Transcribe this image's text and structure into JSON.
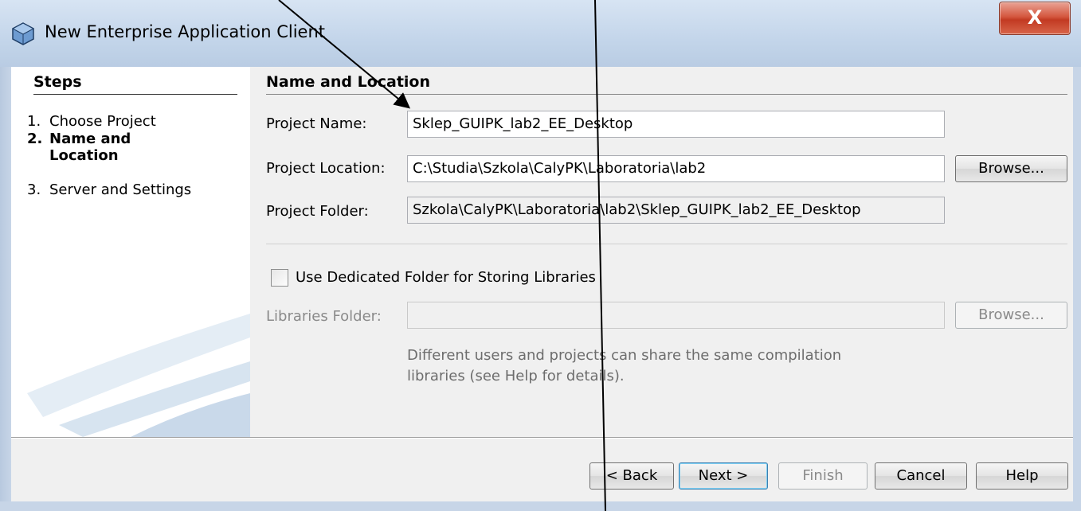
{
  "window": {
    "title": "New Enterprise Application Client",
    "close_label": "X"
  },
  "steps": {
    "heading": "Steps",
    "items": [
      {
        "num": "1.",
        "label": "Choose Project"
      },
      {
        "num": "2.",
        "label": "Name and",
        "label2": "Location"
      },
      {
        "num": "3.",
        "label": "Server and Settings"
      }
    ]
  },
  "panel": {
    "heading": "Name and Location",
    "project_name_label": "Project Name:",
    "project_name_value": "Sklep_GUIPK_lab2_EE_Desktop",
    "project_location_label": "Project Location:",
    "project_location_value": "C:\\Studia\\Szkola\\CalyPK\\Laboratoria\\lab2",
    "browse_label": "Browse...",
    "project_folder_label": "Project Folder:",
    "project_folder_value": "Szkola\\CalyPK\\Laboratoria\\lab2\\Sklep_GUIPK_lab2_EE_Desktop",
    "dedicated_folder_label": "Use Dedicated Folder for Storing Libraries",
    "libraries_folder_label": "Libraries Folder:",
    "libraries_folder_value": "",
    "libraries_browse_label": "Browse...",
    "help_text_line1": "Different users and projects can share the same compilation",
    "help_text_line2": "libraries (see Help for details)."
  },
  "footer": {
    "back_label": "< Back",
    "next_label": "Next >",
    "finish_label": "Finish",
    "cancel_label": "Cancel",
    "help_label": "Help"
  },
  "colors": {
    "client_bg": "#f0f0f0",
    "close_button": "#c23a22",
    "disabled_text": "#8a8a8a"
  }
}
